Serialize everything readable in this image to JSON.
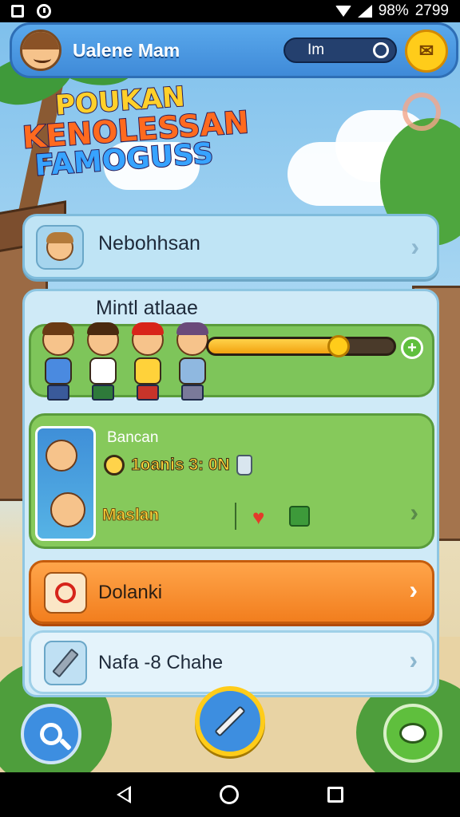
{
  "status_bar": {
    "battery": "98%",
    "time": "2799"
  },
  "header": {
    "player_name": "Ualene Mam",
    "pill_label": "Im"
  },
  "logo": {
    "line1": "POUKAN",
    "line2": "KENOLESSAN",
    "line3": "FAMOGUSS"
  },
  "menu": {
    "top_card_label": "Nebohhsan",
    "section_title": "Mintl atlaae",
    "progress": 0.72,
    "reward": {
      "title": "Bancan",
      "timer": "1oanis 3: 0N",
      "name": "Maslan"
    },
    "orange_card_label": "Dolanki",
    "bottom_card_label": "Nafa -8 Chahe"
  },
  "icons": {
    "avatar": "avatar",
    "search": "search-icon",
    "edit": "pencil-icon",
    "chat": "chat-icon",
    "camera": "camera-icon"
  },
  "colors": {
    "accent_blue": "#3d8ee0",
    "accent_orange": "#f27e1e",
    "accent_green": "#7ec55a",
    "gold": "#ffcc1a"
  }
}
